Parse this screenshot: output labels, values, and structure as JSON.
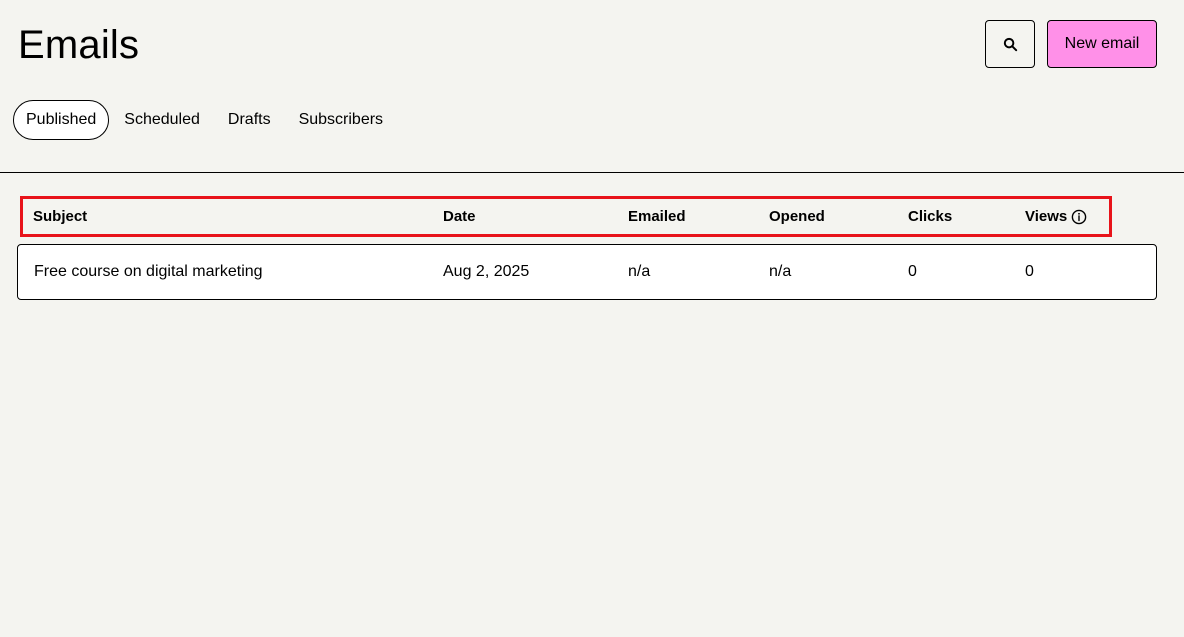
{
  "header": {
    "title": "Emails",
    "new_email_label": "New email"
  },
  "icons": {
    "search": "search-icon",
    "info": "info-icon"
  },
  "colors": {
    "accent": "#ff90e8",
    "highlight_box": "#e8131a",
    "background": "#f4f4f0"
  },
  "tabs": [
    {
      "label": "Published",
      "active": true
    },
    {
      "label": "Scheduled",
      "active": false
    },
    {
      "label": "Drafts",
      "active": false
    },
    {
      "label": "Subscribers",
      "active": false
    }
  ],
  "table": {
    "columns": [
      "Subject",
      "Date",
      "Emailed",
      "Opened",
      "Clicks",
      "Views"
    ],
    "rows": [
      [
        "Free course on digital marketing",
        "Aug 2, 2025",
        "n/a",
        "n/a",
        "0",
        "0"
      ]
    ]
  }
}
